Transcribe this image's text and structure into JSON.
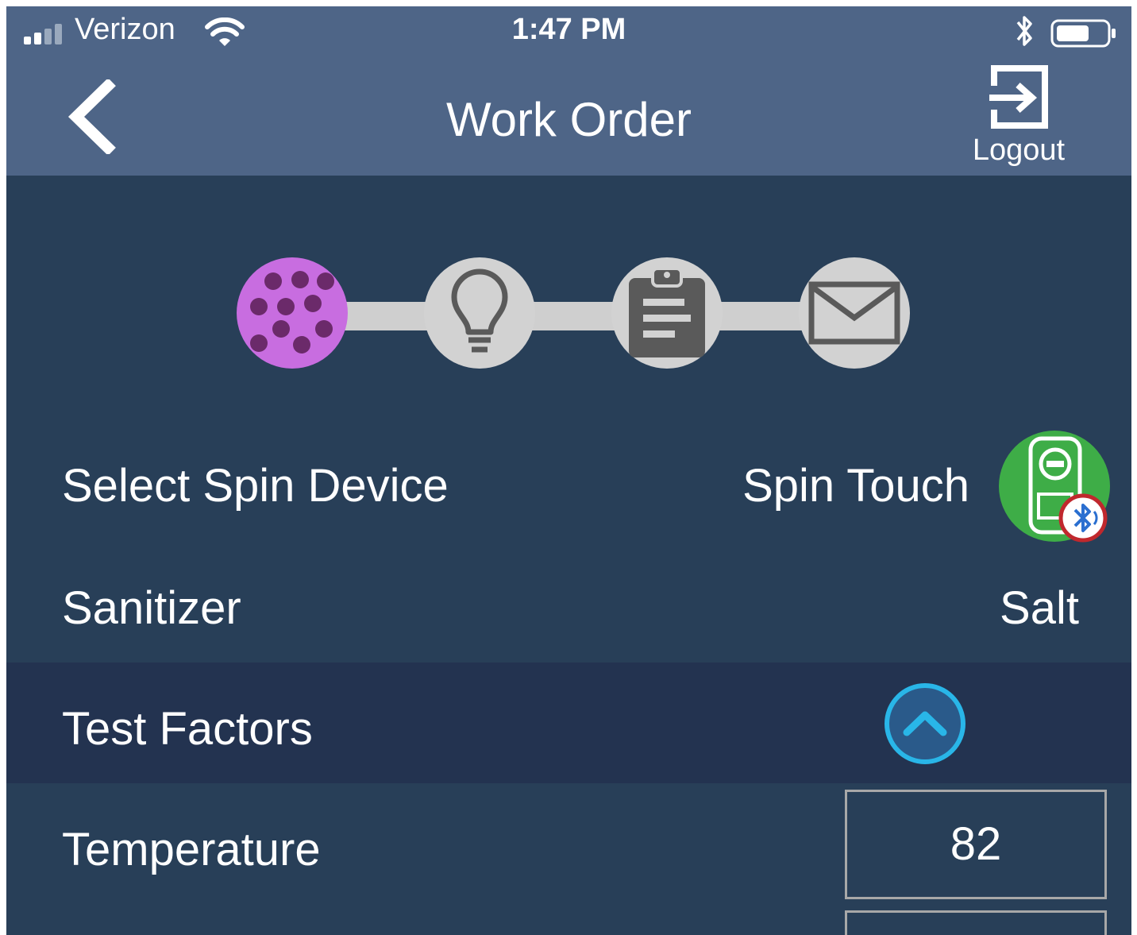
{
  "status_bar": {
    "carrier": "Verizon",
    "time": "1:47 PM",
    "signal_icon": "signal-bars-icon",
    "wifi_icon": "wifi-icon",
    "bluetooth_icon": "bluetooth-icon",
    "battery_icon": "battery-icon"
  },
  "nav": {
    "title": "Work Order",
    "back_icon": "chevron-left-icon",
    "logout_label": "Logout",
    "logout_icon": "logout-icon"
  },
  "stepper": {
    "steps": [
      {
        "icon": "test-dots-icon",
        "active": true
      },
      {
        "icon": "lightbulb-icon",
        "active": false
      },
      {
        "icon": "clipboard-icon",
        "active": false
      },
      {
        "icon": "envelope-icon",
        "active": false
      }
    ],
    "active_color": "#c86de0",
    "inactive_color": "#d2d2d2"
  },
  "rows": {
    "spin_device": {
      "label": "Select Spin Device",
      "value": "Spin Touch",
      "icon": "spin-touch-bluetooth-icon"
    },
    "sanitizer": {
      "label": "Sanitizer",
      "value": "Salt"
    }
  },
  "test_factors": {
    "header": "Test Factors",
    "toggle_icon": "chevron-up-icon",
    "accent": "#29b6e8",
    "temperature": {
      "label": "Temperature",
      "value": "82"
    }
  },
  "colors": {
    "nav_bg": "#4e6587",
    "content_bg": "#283f58",
    "section_bg": "#233350"
  }
}
